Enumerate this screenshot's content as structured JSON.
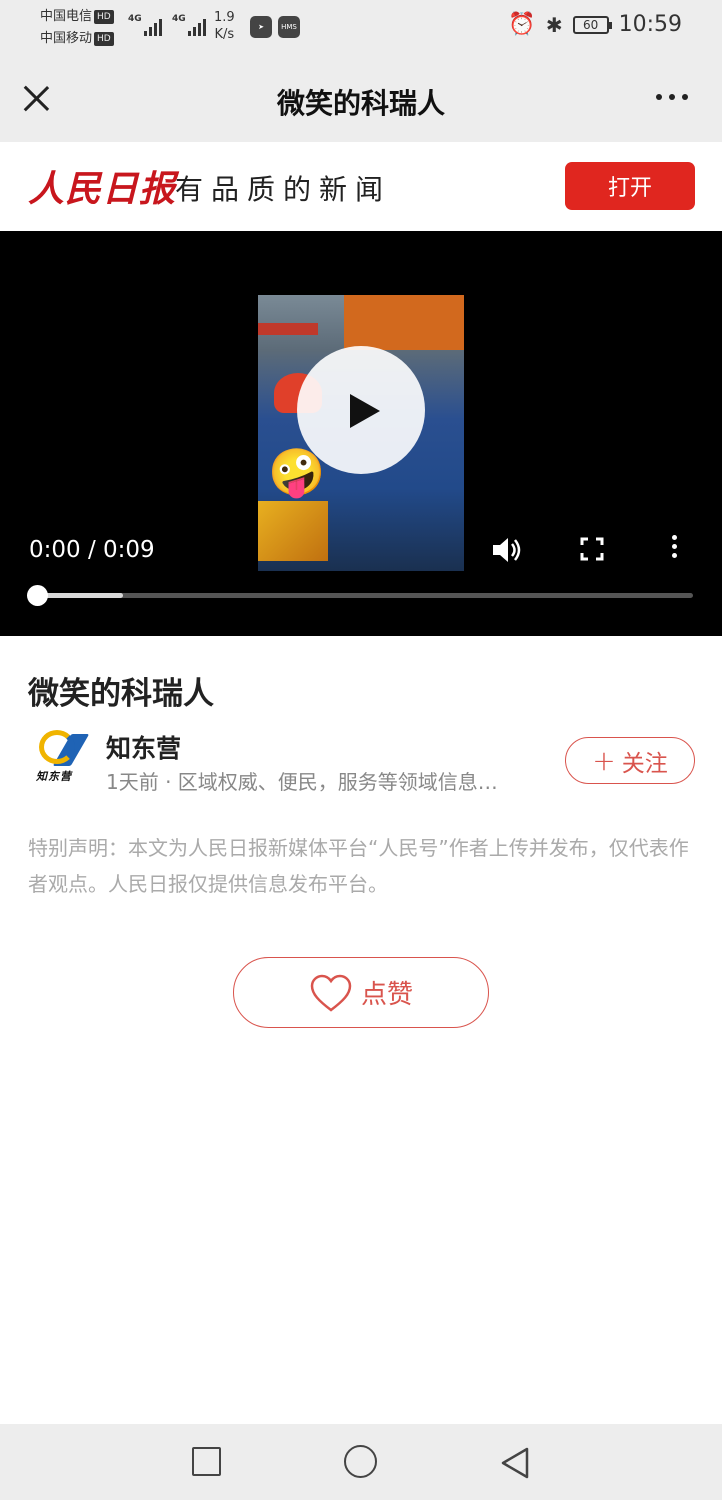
{
  "status_bar": {
    "carrier_1": "中国电信",
    "carrier_2": "中国移动",
    "hd_label": "HD",
    "net_type": "4G",
    "net_speed_value": "1.9",
    "net_speed_unit": "K/s",
    "hms_label": "HMS",
    "battery": "60",
    "time": "10:59"
  },
  "nav": {
    "title": "微笑的科瑞人"
  },
  "banner": {
    "logo": "人民日报",
    "slogan": "有品质的新闻",
    "open_label": "打开"
  },
  "video": {
    "time_display": "0:00 / 0:09",
    "buffered_fraction": 0.14,
    "played_fraction": 0.0
  },
  "article": {
    "title": "微笑的科瑞人",
    "author_name": "知东营",
    "author_logo_text": "知东营",
    "meta": "1天前 · 区域权威、便民，服务等领域信息…",
    "follow_label": "关注",
    "disclaimer": "特别声明：本文为人民日报新媒体平台“人民号”作者上传并发布，仅代表作者观点。人民日报仅提供信息发布平台。",
    "like_label": "点赞"
  },
  "colors": {
    "brand_red": "#e0261f",
    "outline_red": "#d9544d"
  }
}
